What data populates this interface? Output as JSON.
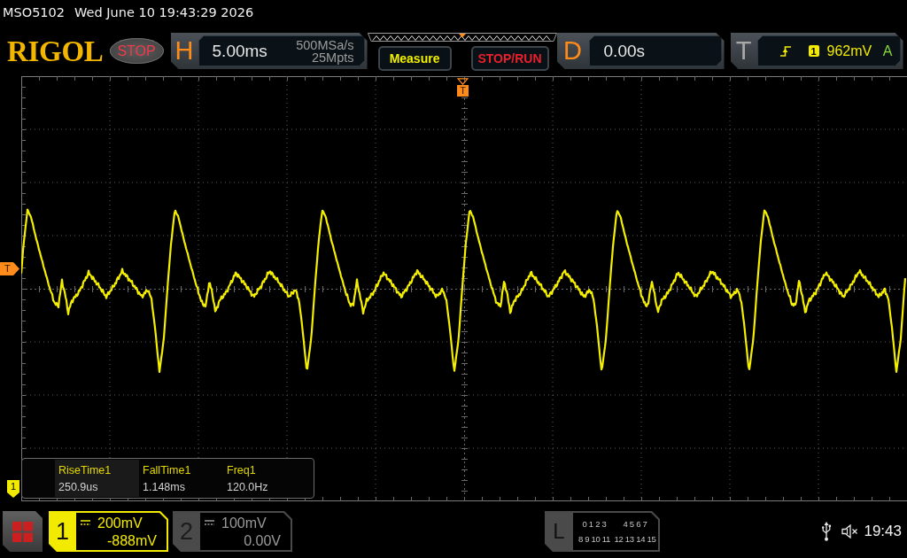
{
  "status_line": {
    "model": "MSO5102",
    "datetime": "Wed June 10 19:43:29 2026"
  },
  "toolbar": {
    "logo": "RIGOL",
    "run_status": "STOP",
    "horizontal": {
      "letter": "H",
      "timebase": "5.00ms",
      "sample_rate": "500MSa/s",
      "memory_depth": "25Mpts"
    },
    "buttons": [
      {
        "label": "Measure",
        "kind": "measure"
      },
      {
        "label": "STOP/RUN",
        "kind": "run_stop"
      }
    ],
    "delay": {
      "letter": "D",
      "value": "0.00s"
    },
    "trigger": {
      "letter": "T",
      "source": "1",
      "level": "962mV",
      "sweep": "A"
    }
  },
  "display": {
    "trigger_position_marker": "T",
    "trigger_level_marker": "T",
    "channel_marker": "1",
    "measurements": [
      {
        "name": "RiseTime1",
        "value": "250.9us",
        "selected": true
      },
      {
        "name": "FallTime1",
        "value": "1.148ms",
        "selected": false
      },
      {
        "name": "Freq1",
        "value": "120.0Hz",
        "selected": false
      }
    ]
  },
  "bottom_bar": {
    "channels": [
      {
        "number": "1",
        "scale": "200mV",
        "offset": "-888mV",
        "on": true
      },
      {
        "number": "2",
        "scale": "100mV",
        "offset": "0.00V",
        "on": false
      }
    ],
    "logic": {
      "letter": "L",
      "rows": [
        [
          "0 1 2 3",
          "4 5 6 7"
        ],
        [
          "8 9 10 11",
          "12 13 14 15"
        ]
      ]
    },
    "tray": {
      "time": "19:43"
    }
  }
}
